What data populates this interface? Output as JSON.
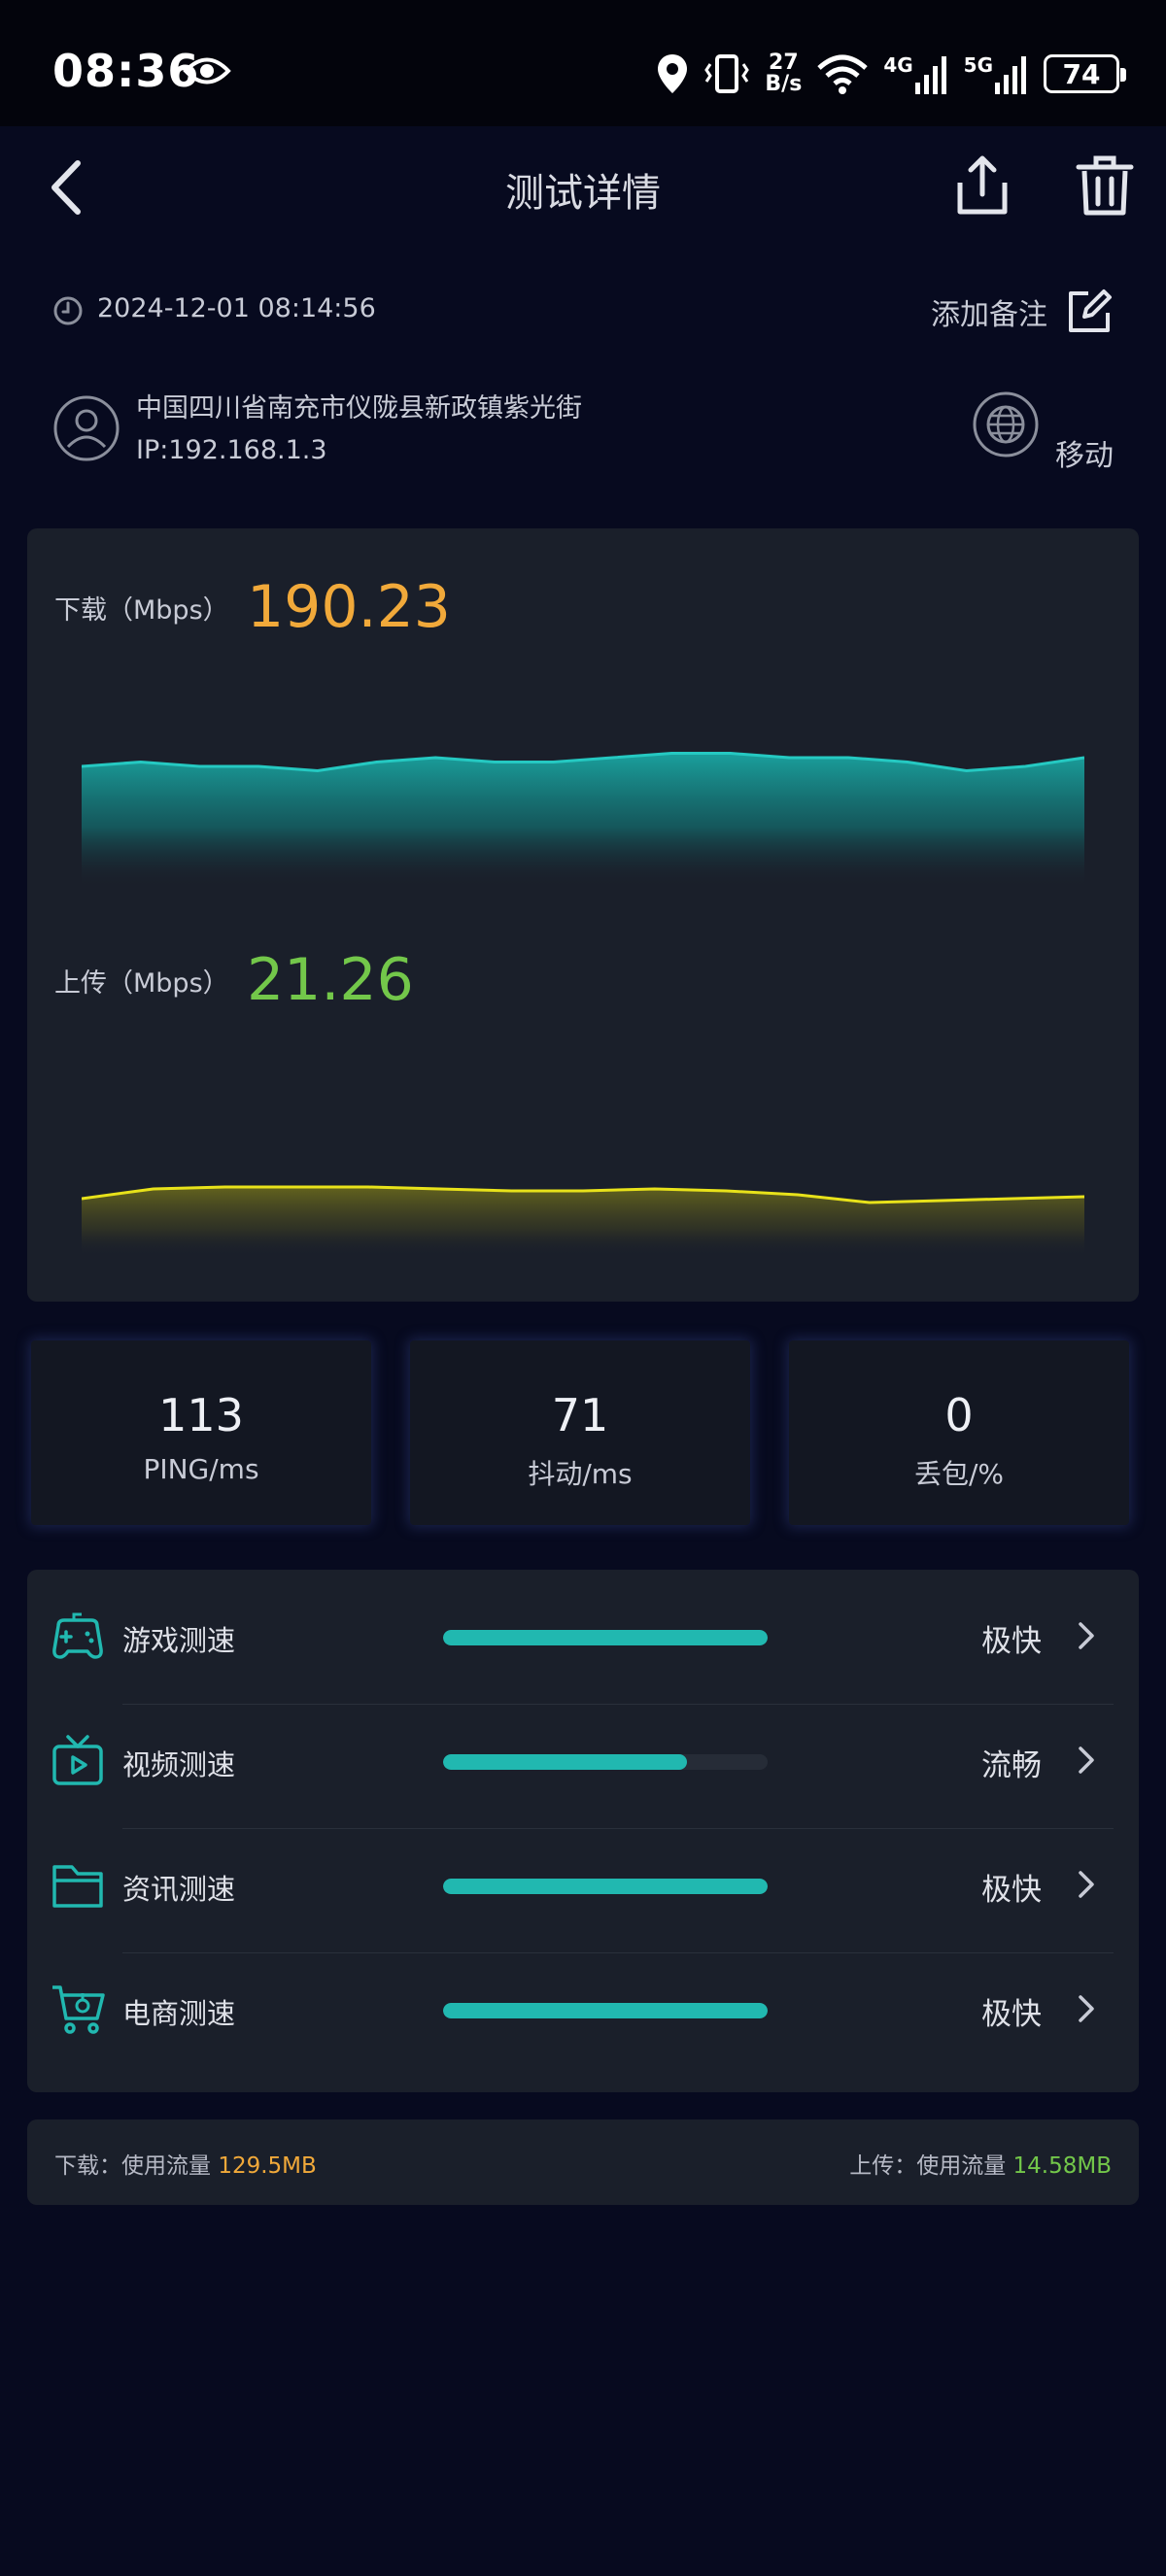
{
  "status_bar": {
    "time": "08:36",
    "net_speed_value": "27",
    "net_speed_unit": "B/s",
    "network_4g": "4G",
    "network_5g": "5G",
    "battery": "74"
  },
  "header": {
    "title": "测试详情"
  },
  "meta": {
    "timestamp": "2024-12-01 08:14:56",
    "add_note": "添加备注"
  },
  "location": {
    "address": "中国四川省南充市仪陇县新政镇紫光街",
    "ip": "IP:192.168.1.3",
    "operator": "移动"
  },
  "download": {
    "label": "下载（Mbps）",
    "value": "190.23",
    "color": "#f1a93a"
  },
  "upload": {
    "label": "上传（Mbps）",
    "value": "21.26",
    "color": "#73c74a"
  },
  "chart_data": [
    {
      "type": "area",
      "series": [
        {
          "values": [
            190,
            191,
            190,
            190,
            189,
            191,
            192,
            191,
            191,
            192,
            193,
            193,
            192,
            192,
            191,
            189,
            190,
            192
          ]
        }
      ]
    },
    {
      "type": "area",
      "series": [
        {
          "values": [
            21.0,
            21.5,
            21.6,
            21.6,
            21.6,
            21.5,
            21.4,
            21.4,
            21.5,
            21.4,
            21.2,
            20.8,
            20.9,
            21.0,
            21.1
          ]
        }
      ]
    }
  ],
  "metrics": [
    {
      "value": "113",
      "label": "PING/ms"
    },
    {
      "value": "71",
      "label": "抖动/ms"
    },
    {
      "value": "0",
      "label": "丢包/%"
    }
  ],
  "categories": [
    {
      "icon": "gamepad-icon",
      "label": "游戏测速",
      "status": "极快",
      "progress": 1.0
    },
    {
      "icon": "tv-icon",
      "label": "视频测速",
      "status": "流畅",
      "progress": 0.75
    },
    {
      "icon": "folder-icon",
      "label": "资讯测速",
      "status": "极快",
      "progress": 1.0
    },
    {
      "icon": "cart-icon",
      "label": "电商测速",
      "status": "极快",
      "progress": 1.0
    }
  ],
  "traffic": {
    "download_label": "下载：使用流量",
    "download_value": "129.5MB",
    "upload_label": "上传：使用流量",
    "upload_value": "14.58MB"
  },
  "colors": {
    "accent_teal": "#21b8b0",
    "download_orange": "#f1a93a",
    "upload_green": "#73c74a",
    "upload_line_yellow": "#e8e21a"
  }
}
